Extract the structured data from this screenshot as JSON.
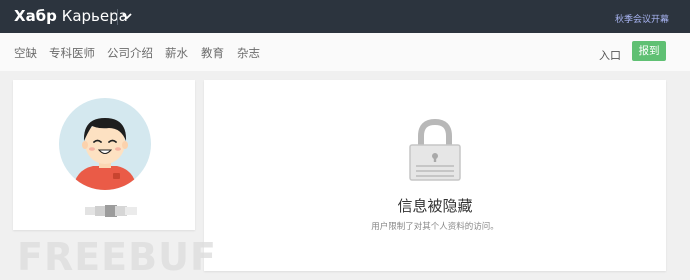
{
  "brand": {
    "name_bold": "Хабр",
    "name_regular": "Карьера"
  },
  "topbar": {
    "right_link": "秋季会议开幕"
  },
  "nav": {
    "items": [
      "空缺",
      "专科医师",
      "公司介绍",
      "薪水",
      "教育",
      "杂志"
    ],
    "login": "入口",
    "signup": "报到"
  },
  "profile": {
    "name": ""
  },
  "hidden": {
    "title": "信息被隐藏",
    "description": "用户限制了对其个人资料的访问。"
  },
  "watermark": "FREEBUF",
  "colors": {
    "topbar": "#2c343e",
    "accent_green": "#5fc073",
    "link_blue": "#a8b4f2",
    "page_bg": "#f0f0f0"
  },
  "icons": {
    "brand_menu": "chevron-down-icon",
    "avatar": "avatar-illustration",
    "lock": "lock-icon"
  }
}
